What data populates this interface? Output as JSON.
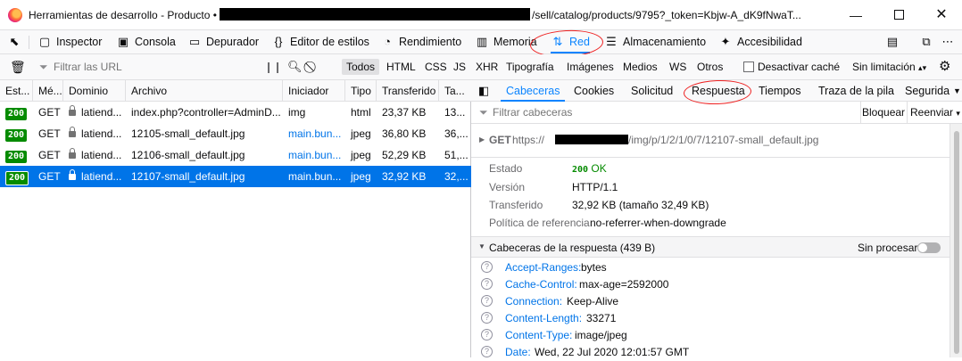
{
  "window": {
    "title": "Herramientas de desarrollo - Producto •",
    "url_tail": "/sell/catalog/products/9795?_token=Kbjw-A_dK9fNwaT..."
  },
  "toolbar": {
    "tools": [
      {
        "label": "Inspector",
        "icon": "inspector-icon"
      },
      {
        "label": "Consola",
        "icon": "console-icon"
      },
      {
        "label": "Depurador",
        "icon": "debugger-icon"
      },
      {
        "label": "Editor de estilos",
        "icon": "style-editor-icon"
      },
      {
        "label": "Rendimiento",
        "icon": "performance-icon"
      },
      {
        "label": "Memoria",
        "icon": "memory-icon"
      },
      {
        "label": "Red",
        "icon": "network-icon",
        "active": true
      },
      {
        "label": "Almacenamiento",
        "icon": "storage-icon"
      },
      {
        "label": "Accesibilidad",
        "icon": "accessibility-icon"
      }
    ]
  },
  "filterbar": {
    "placeholder": "Filtrar las URL",
    "types": [
      "Todos",
      "HTML",
      "CSS",
      "JS",
      "XHR",
      "Tipografía",
      "Imágenes",
      "Medios",
      "WS",
      "Otros"
    ],
    "selected_type": "Todos",
    "disable_cache": "Desactivar caché",
    "throttling": "Sin limitación"
  },
  "table": {
    "columns": [
      "Est...",
      "Mé...",
      "Dominio",
      "Archivo",
      "Iniciador",
      "Tipo",
      "Transferido",
      "Ta..."
    ],
    "rows": [
      {
        "status": "200",
        "method": "GET",
        "domain": "latiend...",
        "file": "index.php?controller=AdminD...",
        "initiator": "img",
        "type": "html",
        "transferred": "23,37 KB",
        "size": "13...",
        "selected": false
      },
      {
        "status": "200",
        "method": "GET",
        "domain": "latiend...",
        "file": "12105-small_default.jpg",
        "initiator": "main.bun...",
        "type": "jpeg",
        "transferred": "36,80 KB",
        "size": "36,...",
        "selected": false
      },
      {
        "status": "200",
        "method": "GET",
        "domain": "latiend...",
        "file": "12106-small_default.jpg",
        "initiator": "main.bun...",
        "type": "jpeg",
        "transferred": "52,29 KB",
        "size": "51,...",
        "selected": false
      },
      {
        "status": "200",
        "method": "GET",
        "domain": "latiend...",
        "file": "12107-small_default.jpg",
        "initiator": "main.bun...",
        "type": "jpeg",
        "transferred": "32,92 KB",
        "size": "32,...",
        "selected": true
      }
    ]
  },
  "side": {
    "tabs": [
      "Cabeceras",
      "Cookies",
      "Solicitud",
      "Respuesta",
      "Tiempos",
      "Traza de la pila",
      "Segurida"
    ],
    "active_tab": "Cabeceras",
    "filter_placeholder": "Filtrar cabeceras",
    "block_label": "Bloquear",
    "resend_label": "Reenviar",
    "request": {
      "method": "GET",
      "scheme": "https://",
      "path": "/img/p/1/2/1/0/7/12107-small_default.jpg"
    },
    "summary": {
      "status_key": "Estado",
      "status_code": "200",
      "status_text": "OK",
      "version_key": "Versión",
      "version_val": "HTTP/1.1",
      "transferred_key": "Transferido",
      "transferred_val": "32,92 KB (tamaño 32,49 KB)",
      "referrer_key": "Política de referencia",
      "referrer_val": "no-referrer-when-downgrade"
    },
    "response_section": {
      "title": "Cabeceras de la respuesta (439 B)",
      "raw_label": "Sin procesar",
      "headers": [
        {
          "name": "Accept-Ranges:",
          "value": "bytes"
        },
        {
          "name": "Cache-Control:",
          "value": "max-age=2592000"
        },
        {
          "name": "Connection:",
          "value": "Keep-Alive"
        },
        {
          "name": "Content-Length:",
          "value": "33271"
        },
        {
          "name": "Content-Type:",
          "value": "image/jpeg"
        },
        {
          "name": "Date:",
          "value": "Wed, 22 Jul 2020 12:01:57 GMT"
        }
      ]
    }
  },
  "colors": {
    "accent": "#0a84ff",
    "selected_row": "#0074e8",
    "status_ok": "#058b00",
    "annotation": "#e22222"
  }
}
